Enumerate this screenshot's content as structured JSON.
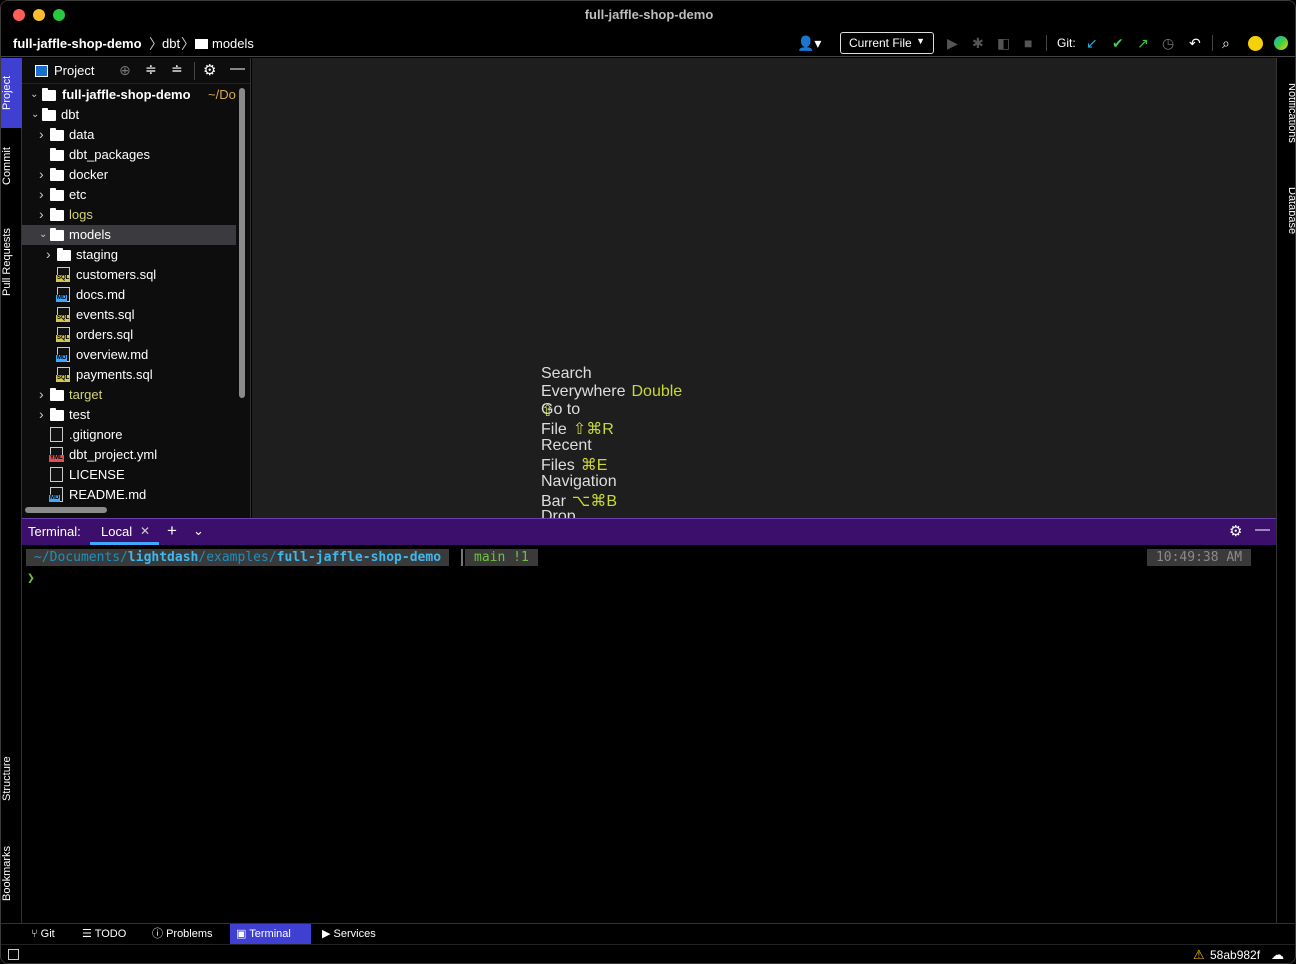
{
  "window": {
    "title": "full-jaffle-shop-demo"
  },
  "navbar": {
    "breadcrumbs": [
      "full-jaffle-shop-demo",
      "dbt",
      "models"
    ],
    "run_config": "Current File",
    "git_label": "Git:"
  },
  "left_tabs": [
    "Project",
    "Commit",
    "Pull Requests",
    "Structure",
    "Bookmarks"
  ],
  "right_tabs": [
    "Notifications",
    "Database"
  ],
  "project": {
    "header": "Project",
    "root_name": "full-jaffle-shop-demo",
    "root_path": "~/Do",
    "tree": [
      {
        "label": "dbt",
        "kind": "folder",
        "depth": 1,
        "chevron": "open"
      },
      {
        "label": "data",
        "kind": "folder",
        "depth": 2,
        "chevron": "closed"
      },
      {
        "label": "dbt_packages",
        "kind": "folder",
        "depth": 2,
        "chevron": ""
      },
      {
        "label": "docker",
        "kind": "folder",
        "depth": 2,
        "chevron": "closed"
      },
      {
        "label": "etc",
        "kind": "folder",
        "depth": 2,
        "chevron": "closed"
      },
      {
        "label": "logs",
        "kind": "folder",
        "depth": 2,
        "chevron": "closed",
        "muted": true
      },
      {
        "label": "models",
        "kind": "folder",
        "depth": 2,
        "chevron": "open",
        "selected": true
      },
      {
        "label": "staging",
        "kind": "folder",
        "depth": 3,
        "chevron": "closed"
      },
      {
        "label": "customers.sql",
        "kind": "sql",
        "depth": 3
      },
      {
        "label": "docs.md",
        "kind": "md",
        "depth": 3
      },
      {
        "label": "events.sql",
        "kind": "sql",
        "depth": 3
      },
      {
        "label": "orders.sql",
        "kind": "sql",
        "depth": 3
      },
      {
        "label": "overview.md",
        "kind": "md",
        "depth": 3
      },
      {
        "label": "payments.sql",
        "kind": "sql",
        "depth": 3
      },
      {
        "label": "target",
        "kind": "folder",
        "depth": 2,
        "chevron": "closed",
        "muted": true
      },
      {
        "label": "test",
        "kind": "folder",
        "depth": 2,
        "chevron": "closed"
      },
      {
        "label": ".gitignore",
        "kind": "git",
        "depth": 2
      },
      {
        "label": "dbt_project.yml",
        "kind": "yml",
        "depth": 2
      },
      {
        "label": "LICENSE",
        "kind": "txt",
        "depth": 2
      },
      {
        "label": "README.md",
        "kind": "md",
        "depth": 2
      }
    ]
  },
  "editor": {
    "hints": [
      {
        "text": "Search Everywhere",
        "keys": "Double ⇧"
      },
      {
        "text": "Go to File",
        "keys": "⇧⌘R"
      },
      {
        "text": "Recent Files",
        "keys": "⌘E"
      },
      {
        "text": "Navigation Bar",
        "keys": "⌥⌘B"
      },
      {
        "text": "Drop files here to open them",
        "keys": ""
      }
    ]
  },
  "terminal": {
    "label": "Terminal:",
    "tab": "Local",
    "path_prefix": "~/Documents/",
    "path_bold1": "lightdash",
    "path_mid": "/examples/",
    "path_bold2": "full-jaffle-shop-demo",
    "branch": "main !1",
    "time": "10:49:38 AM",
    "prompt": "❯"
  },
  "bottom_tabs": [
    "Git",
    "TODO",
    "Problems",
    "Terminal",
    "Services"
  ],
  "status": {
    "commit": "58ab982f"
  },
  "colors": {
    "accent": "#3f3fd1",
    "terminal_bar": "#3b0f6b",
    "hint_key": "#c8d933",
    "git_green": "#3ccf3c",
    "git_blue": "#29a8e0"
  }
}
